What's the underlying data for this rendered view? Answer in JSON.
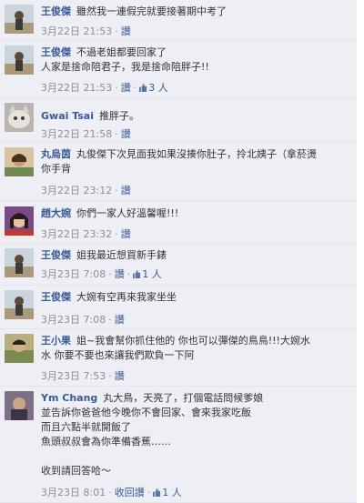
{
  "comments": [
    {
      "name": "王俊傑",
      "lines": [
        "雖然我一連假完就要接著期中考了"
      ],
      "date": "3月22日",
      "time": "21:53",
      "like_label": "讚",
      "likes": ""
    },
    {
      "name": "王俊傑",
      "lines": [
        "不過老姐都要回家了",
        "人家是捨命陪君子，我是捨命陪胖子!!"
      ],
      "date": "3月22日",
      "time": "21:53",
      "like_label": "讚",
      "likes": "3 人"
    },
    {
      "name": "Gwai Tsai",
      "lines": [
        "推胖子。"
      ],
      "date": "3月22日",
      "time": "21:58",
      "like_label": "讚",
      "likes": ""
    },
    {
      "name": "丸烏茵",
      "lines": [
        "丸俊傑下次見面我如果沒揍你肚子，拎北姨子（拿菸燙",
        "你手背"
      ],
      "date": "3月22日",
      "time": "23:12",
      "like_label": "讚",
      "likes": ""
    },
    {
      "name": "趙大婉",
      "lines": [
        "你們一家人好溫馨喔!!!"
      ],
      "date": "3月22日",
      "time": "23:32",
      "like_label": "讚",
      "likes": ""
    },
    {
      "name": "王俊傑",
      "lines": [
        "姐我最近想買新手錶"
      ],
      "date": "3月23日",
      "time": "7:08",
      "like_label": "讚",
      "likes": "1 人"
    },
    {
      "name": "王俊傑",
      "lines": [
        "大婉有空再來我家坐坐"
      ],
      "date": "3月23日",
      "time": "7:08",
      "like_label": "讚",
      "likes": ""
    },
    {
      "name": "王小果",
      "lines": [
        "姐~我會幫你抓住他的  你也可以彈傑的鳥鳥!!!大婉水",
        "水  你要不要也來讓我們欺負一下阿"
      ],
      "date": "3月23日",
      "time": "7:53",
      "like_label": "讚",
      "likes": ""
    },
    {
      "name": "Ym Chang",
      "lines": [
        "丸大鳥，天亮了，打個電話問候爹娘",
        "並告訴你爸爸他今晚你不會回家、會來我家吃飯",
        "而且六點半就開飯了",
        "魚頭叔叔會為你準備香蕉……",
        "",
        "收到請回答哈～"
      ],
      "date": "3月23日",
      "time": "8:01",
      "like_label": "收回讚",
      "likes": "1 人"
    }
  ]
}
